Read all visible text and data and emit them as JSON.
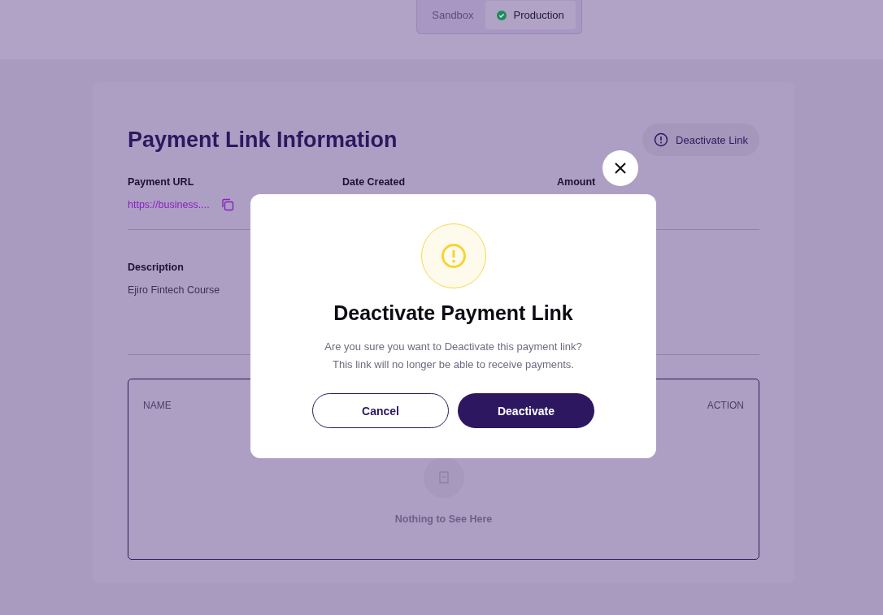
{
  "environment_tabs": [
    {
      "label": "Sandbox",
      "selected": false
    },
    {
      "label": "Production",
      "selected": true
    }
  ],
  "page": {
    "title": "Payment Link Information",
    "action_button": "Deactivate Link",
    "fields": [
      {
        "label": "Payment URL",
        "value": "https://business....",
        "kind": "link"
      },
      {
        "label": "Date Created"
      },
      {
        "label": "Amount"
      }
    ],
    "description": {
      "label": "Description",
      "value": "Ejiro Fintech Course"
    },
    "table": {
      "columns": [
        "NAME",
        "ACTION"
      ],
      "empty_text": "Nothing to See Here"
    }
  },
  "modal": {
    "title": "Deactivate Payment Link",
    "message_lines": [
      "Are you sure you want to Deactivate this payment link?",
      "This link will no longer be able to receive payments."
    ],
    "buttons": [
      {
        "label": "Cancel",
        "kind": "secondary"
      },
      {
        "label": "Deactivate",
        "kind": "primary"
      }
    ]
  }
}
